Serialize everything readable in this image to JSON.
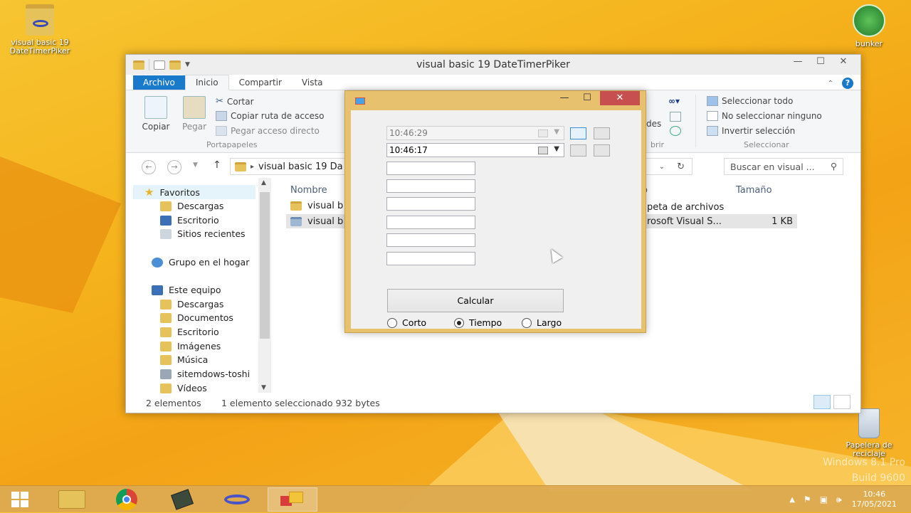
{
  "desktop": {
    "icon_vb": "visual basic 19 DateTimerPiker",
    "icon_bunker": "bunker",
    "icon_recycle": "Papelera de reciclaje",
    "watermark_line1": "Windows 8.1 Pro",
    "watermark_line2": "Build 9600"
  },
  "explorer": {
    "title": "visual basic 19 DateTimerPiker",
    "tabs": [
      "Archivo",
      "Inicio",
      "Compartir",
      "Vista"
    ],
    "ribbon": {
      "copy": "Copiar",
      "paste": "Pegar",
      "cut": "Cortar",
      "copy_path": "Copiar ruta de acceso",
      "paste_shortcut": "Pegar acceso directo",
      "group_clipboard": "Portapapeles",
      "select_all": "Seleccionar todo",
      "select_none": "No seleccionar ninguno",
      "invert_selection": "Invertir selección",
      "group_select": "Seleccionar",
      "partial_des": "des",
      "partial_brir": "brir"
    },
    "address": "visual basic 19 Da",
    "search_placeholder": "Buscar en visual ...",
    "nav": {
      "favorites": "Favoritos",
      "downloads": "Descargas",
      "desktop": "Escritorio",
      "recent": "Sitios recientes",
      "homegroup": "Grupo en el hogar",
      "thispc": "Este equipo",
      "pc_downloads": "Descargas",
      "documents": "Documentos",
      "pc_desktop": "Escritorio",
      "images": "Imágenes",
      "music": "Música",
      "sitemdows": "sitemdows-toshi",
      "videos": "Vídeos"
    },
    "columns": {
      "name": "Nombre",
      "type_partial": "o",
      "size": "Tamaño"
    },
    "files": [
      {
        "name": "visual b",
        "type": "peta de archivos",
        "size": ""
      },
      {
        "name": "visual b",
        "type": "rosoft Visual S...",
        "size": "1 KB"
      }
    ],
    "status": {
      "count": "2 elementos",
      "selected": "1 elemento seleccionado  932 bytes"
    }
  },
  "form": {
    "dtp1": "10:46:29",
    "dtp2": "10:46:17",
    "calc_label": "Calcular",
    "radio_short": "Corto",
    "radio_time": "Tiempo",
    "radio_long": "Largo",
    "selected_radio": "Tiempo"
  },
  "taskbar": {
    "time": "10:46",
    "date": "17/05/2021"
  },
  "colors": {
    "accent": "#1979ca",
    "close_red": "#c74f4f",
    "form_frame": "#e7c16e"
  }
}
